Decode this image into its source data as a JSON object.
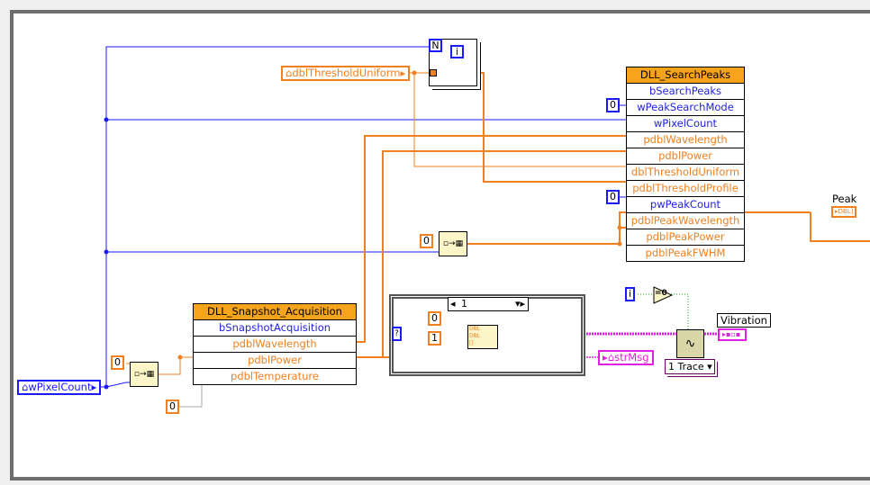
{
  "colors": {
    "double": "#f08020",
    "integer": "#1a1aff",
    "string": "#e020e0",
    "node_header": "#f6a41c",
    "frame": "#6e6e6e"
  },
  "for_loop": {
    "count_terminal": "N",
    "iteration_terminal": "i"
  },
  "controls": {
    "threshold": "dblThresholdUniform",
    "pixel_count": "wPixelCount",
    "str_msg": "strMsg"
  },
  "search_peaks": {
    "title": "DLL_SearchPeaks",
    "rows": [
      {
        "label": "bSearchPeaks",
        "type": "integer"
      },
      {
        "label": "wPeakSearchMode",
        "type": "integer"
      },
      {
        "label": "wPixelCount",
        "type": "integer"
      },
      {
        "label": "pdblWavelength",
        "type": "double"
      },
      {
        "label": "pdblPower",
        "type": "double"
      },
      {
        "label": "dblThresholdUniform",
        "type": "double"
      },
      {
        "label": "pdblThresholdProfile",
        "type": "double"
      },
      {
        "label": "pwPeakCount",
        "type": "integer"
      },
      {
        "label": "pdblPeakWavelength",
        "type": "double"
      },
      {
        "label": "pdblPeakPower",
        "type": "double"
      },
      {
        "label": "pdblPeakFWHM",
        "type": "double"
      }
    ]
  },
  "snapshot": {
    "title": "DLL_Snapshot_Acquisition",
    "rows": [
      {
        "label": "bSnapshotAcquisition",
        "type": "integer"
      },
      {
        "label": "pdblWavelength",
        "type": "double"
      },
      {
        "label": "pdblPower",
        "type": "double"
      },
      {
        "label": "pdblTemperature",
        "type": "double"
      }
    ]
  },
  "constants": {
    "peak_mode": "0",
    "peak_count": "0",
    "init_array": "0",
    "snap_init": "0",
    "temperature": "0",
    "bundle_x0": "0",
    "bundle_dx": "1"
  },
  "case_structure": {
    "selector": "1",
    "selector_terminal": "?"
  },
  "bundle": {
    "inputs": [
      "DBL",
      "DBL",
      "[]"
    ]
  },
  "compare": {
    "label": "=0",
    "input": "i"
  },
  "indicators": {
    "peak": "Peak",
    "peak_type": "DBL",
    "vibration": "Vibration"
  },
  "chart": {
    "trace_selector": "1 Trace"
  }
}
